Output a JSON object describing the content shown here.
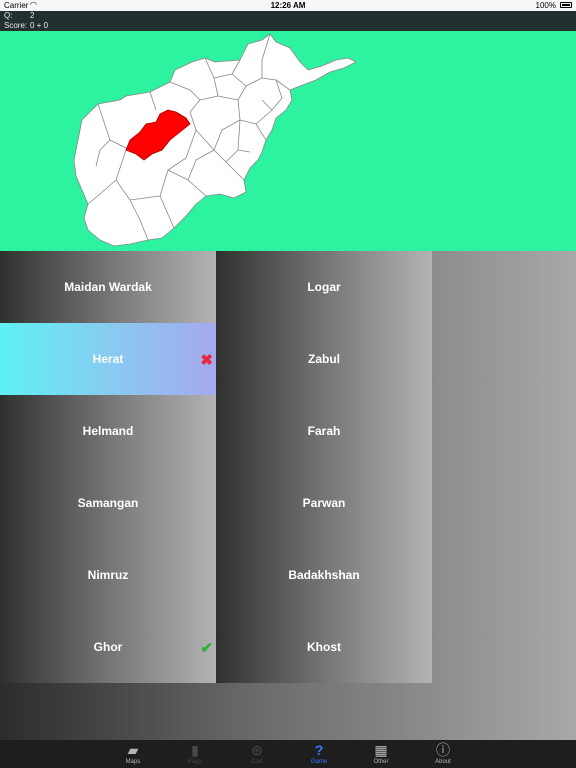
{
  "status_bar": {
    "carrier": "Carrier",
    "time": "12:26 AM",
    "battery": "100%"
  },
  "info": {
    "q_label": "Q:",
    "q_value": "2",
    "score_label": "Score:",
    "score_value": "0 + 0"
  },
  "colors": {
    "map_background": "#2df3a1",
    "highlight_region": "#ff0000",
    "active_tab": "#2e7cf6",
    "wrong_mark": "#e8263c",
    "right_mark": "#2fb12f"
  },
  "answers": [
    {
      "label": "Maidan Wardak"
    },
    {
      "label": "Logar"
    },
    {
      "label": "Herat",
      "selected": true,
      "mark": "✖",
      "mark_icon": "cross-icon"
    },
    {
      "label": "Zabul"
    },
    {
      "label": "Helmand"
    },
    {
      "label": "Farah"
    },
    {
      "label": "Samangan"
    },
    {
      "label": "Parwan"
    },
    {
      "label": "Nimruz"
    },
    {
      "label": "Badakhshan"
    },
    {
      "label": "Ghor",
      "mark": "✔",
      "mark_icon": "check-icon"
    },
    {
      "label": "Khost"
    }
  ],
  "tabs": [
    {
      "label": "Maps",
      "icon": "map-icon",
      "state": "normal"
    },
    {
      "label": "Flags",
      "icon": "flag-icon",
      "state": "disabled"
    },
    {
      "label": "CoA",
      "icon": "coat-of-arms-icon",
      "state": "disabled"
    },
    {
      "label": "Game",
      "icon": "question-icon",
      "state": "active"
    },
    {
      "label": "Other",
      "icon": "grid-icon",
      "state": "normal"
    },
    {
      "label": "About",
      "icon": "info-icon",
      "state": "normal"
    }
  ]
}
